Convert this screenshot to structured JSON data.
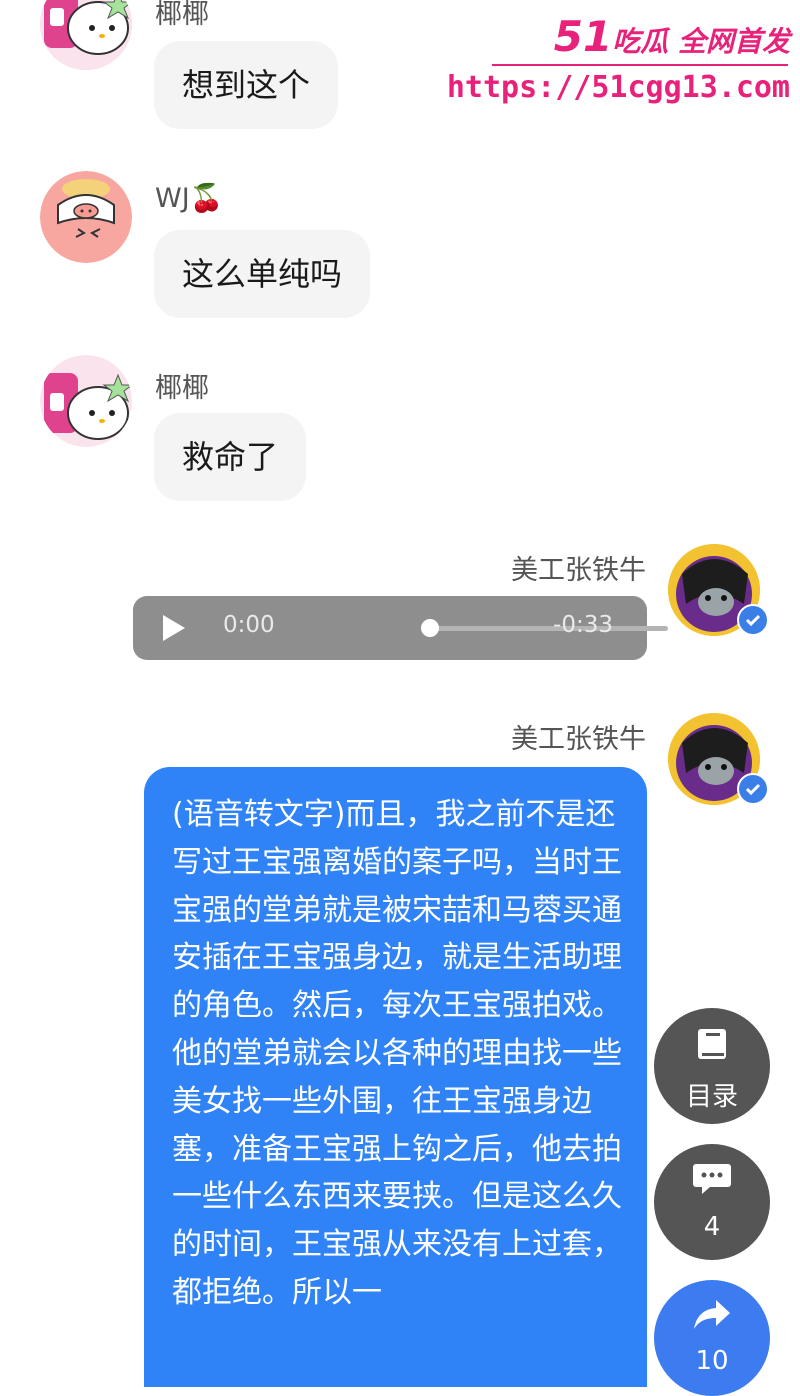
{
  "watermark": {
    "brand_number": "51",
    "brand_text": "吃瓜 全网首发",
    "url": "https://51cgg13.com"
  },
  "messages": [
    {
      "sender": "椰椰",
      "text": "想到这个"
    },
    {
      "sender": "WJ🍒",
      "text": "这么单纯吗"
    },
    {
      "sender": "椰椰",
      "text": "救命了"
    },
    {
      "sender": "美工张铁牛",
      "audio": {
        "current": "0:00",
        "remaining": "-0:33"
      }
    },
    {
      "sender": "美工张铁牛",
      "text": "(语音转文字)而且，我之前不是还写过王宝强离婚的案子吗，当时王宝强的堂弟就是被宋喆和马蓉买通安插在王宝强身边，就是生活助理的角色。然后，每次王宝强拍戏。他的堂弟就会以各种的理由找一些美女找一些外围，往王宝强身边塞，准备王宝强上钩之后，他去拍一些什么东西来要挟。但是这么久的时间，王宝强从来没有上过套，都拒绝。所以一"
    }
  ],
  "floating_buttons": {
    "toc_label": "目录",
    "comment_count": "4",
    "share_count": "10"
  },
  "colors": {
    "accent_blue": "#2f83f6",
    "watermark_pink": "#e8217a",
    "fab_gray": "#555555"
  },
  "icons": [
    "book-icon",
    "comment-icon",
    "share-icon",
    "play-icon",
    "verified-icon"
  ]
}
